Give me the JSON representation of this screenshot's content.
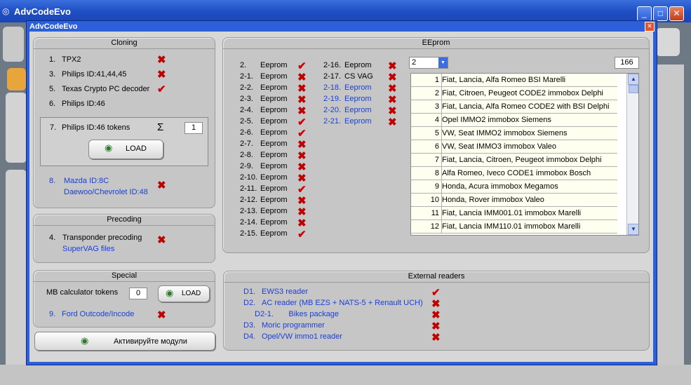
{
  "background_window": {
    "title": "AdvCodeEvo",
    "controls": {
      "minimize": "_",
      "maximize": "□",
      "close": "✕"
    }
  },
  "dialog": {
    "title": "AdvCodeEvo",
    "close": "✕"
  },
  "cloning": {
    "title": "Cloning",
    "items": [
      {
        "num": "1.",
        "label": "TPX2",
        "status": "cross"
      },
      {
        "num": "3.",
        "label": "Philips ID:41,44,45",
        "status": "cross"
      },
      {
        "num": "5.",
        "label": "Texas Crypto PC decoder",
        "status": "check"
      },
      {
        "num": "6.",
        "label": "Philips ID:46",
        "status": "none"
      }
    ],
    "tokens": {
      "num": "7.",
      "label": "Philips ID:46 tokens",
      "sigma": "Σ",
      "value": "1",
      "load_label": "LOAD"
    },
    "mazda": {
      "num": "8.",
      "line1": "Mazda ID:8C",
      "line2": "Daewoo/Chevrolet ID:48"
    }
  },
  "precoding": {
    "title": "Precoding",
    "num": "4.",
    "label": "Transponder precoding",
    "sublabel": "SuperVAG files"
  },
  "special": {
    "title": "Special",
    "mb_label": "MB calculator tokens",
    "mb_value": "0",
    "load_label": "LOAD",
    "ford_num": "9.",
    "ford_label": "Ford Outcode/Incode"
  },
  "activate_label": "Активируйте модули",
  "eeprom": {
    "title": "EEprom",
    "col1": [
      {
        "num": "2.",
        "label": "Eeprom",
        "status": "check"
      },
      {
        "num": "2-1.",
        "label": "Eeprom",
        "status": "cross"
      },
      {
        "num": "2-2.",
        "label": "Eeprom",
        "status": "cross"
      },
      {
        "num": "2-3.",
        "label": "Eeprom",
        "status": "cross"
      },
      {
        "num": "2-4.",
        "label": "Eeprom",
        "status": "cross"
      },
      {
        "num": "2-5.",
        "label": "Eeprom",
        "status": "check"
      },
      {
        "num": "2-6.",
        "label": "Eeprom",
        "status": "check"
      },
      {
        "num": "2-7.",
        "label": "Eeprom",
        "status": "cross"
      },
      {
        "num": "2-8.",
        "label": "Eeprom",
        "status": "cross"
      },
      {
        "num": "2-9.",
        "label": "Eeprom",
        "status": "cross"
      },
      {
        "num": "2-10.",
        "label": "Eeprom",
        "status": "cross"
      },
      {
        "num": "2-11.",
        "label": "Eeprom",
        "status": "check"
      },
      {
        "num": "2-12.",
        "label": "Eeprom",
        "status": "cross"
      },
      {
        "num": "2-13.",
        "label": "Eeprom",
        "status": "cross"
      },
      {
        "num": "2-14.",
        "label": "Eeprom",
        "status": "cross"
      },
      {
        "num": "2-15.",
        "label": "Eeprom",
        "status": "check"
      }
    ],
    "col2": [
      {
        "num": "2-16.",
        "label": "Eeprom",
        "status": "cross",
        "blue": false
      },
      {
        "num": "2-17.",
        "label": "CS VAG",
        "status": "cross",
        "blue": false
      },
      {
        "num": "2-18.",
        "label": "Eeprom",
        "status": "cross",
        "blue": true
      },
      {
        "num": "2-19.",
        "label": "Eeprom",
        "status": "cross",
        "blue": true
      },
      {
        "num": "2-20.",
        "label": "Eeprom",
        "status": "cross",
        "blue": true
      },
      {
        "num": "2-21.",
        "label": "Eeprom",
        "status": "cross",
        "blue": true
      }
    ],
    "select_value": "2",
    "count": "166",
    "list": [
      {
        "n": "1",
        "d": "Fiat, Lancia, Alfa Romeo BSI Marelli"
      },
      {
        "n": "2",
        "d": "Fiat, Citroen, Peugeot CODE2 immobox Delphi"
      },
      {
        "n": "3",
        "d": "Fiat, Lancia, Alfa Romeo CODE2 with BSI Delphi"
      },
      {
        "n": "4",
        "d": "Opel IMMO2 immobox Siemens"
      },
      {
        "n": "5",
        "d": "VW, Seat IMMO2 immobox Siemens"
      },
      {
        "n": "6",
        "d": "VW, Seat IMMO3 immobox Valeo"
      },
      {
        "n": "7",
        "d": "Fiat, Lancia, Citroen, Peugeot immobox Delphi"
      },
      {
        "n": "8",
        "d": "Alfa Romeo, Iveco CODE1 immobox Bosch"
      },
      {
        "n": "9",
        "d": "Honda, Acura immobox Megamos"
      },
      {
        "n": "10",
        "d": "Honda, Rover immobox Valeo"
      },
      {
        "n": "11",
        "d": "Fiat, Lancia IMM001.01 immobox Marelli"
      },
      {
        "n": "12",
        "d": "Fiat, Lancia IMM110.01 immobox Marelli"
      }
    ]
  },
  "external": {
    "title": "External readers",
    "items": [
      {
        "num": "D1.",
        "label": "EWS3 reader",
        "status": "check"
      },
      {
        "num": "D2.",
        "label": "AC reader  (MB EZS + NATS-5 + Renault UCH)",
        "status": "cross"
      },
      {
        "num": "D2-1.",
        "label": "Bikes package",
        "status": "cross"
      },
      {
        "num": "D3.",
        "label": "Moric programmer",
        "status": "cross"
      },
      {
        "num": "D4.",
        "label": "Opel/VW immo1 reader",
        "status": "cross"
      }
    ]
  },
  "icons": {
    "cross": "✖",
    "check": "✔",
    "globe": "◉",
    "arrow_down": "▼",
    "arrow_up": "▲"
  },
  "colors": {
    "accent": "#2c5fd8",
    "status_red": "#c00000",
    "link_blue": "#1a3fd8"
  }
}
